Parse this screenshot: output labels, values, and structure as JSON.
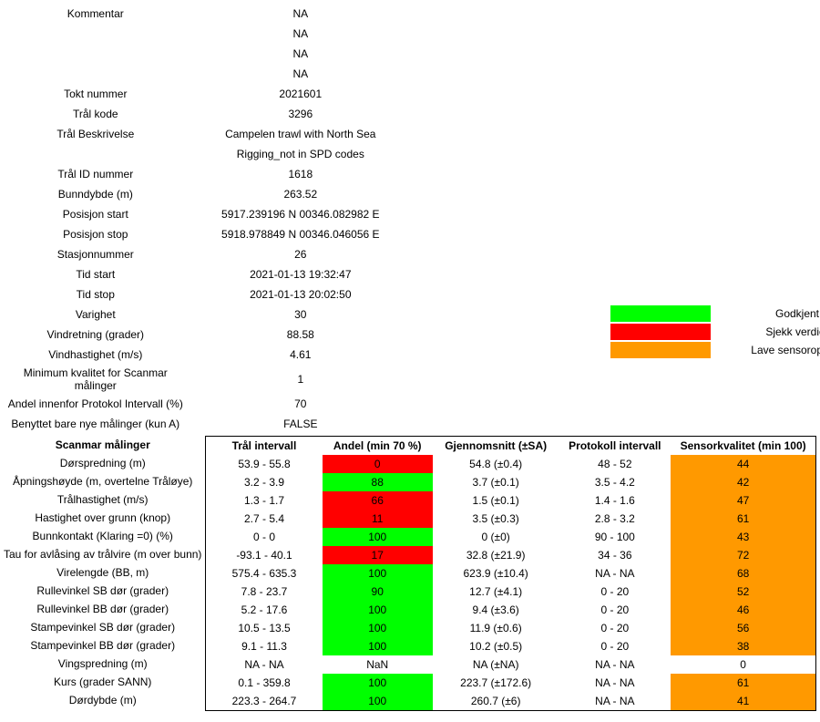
{
  "meta": [
    {
      "label": "Kommentar",
      "value": "NA"
    },
    {
      "label": "",
      "value": "NA"
    },
    {
      "label": "",
      "value": "NA"
    },
    {
      "label": "",
      "value": "NA"
    },
    {
      "label": "Tokt nummer",
      "value": "2021601"
    },
    {
      "label": "Trål kode",
      "value": "3296"
    },
    {
      "label": "Trål Beskrivelse",
      "value": "Campelen trawl with North Sea"
    },
    {
      "label": "",
      "value": "Rigging_not in SPD codes"
    },
    {
      "label": "Trål ID nummer",
      "value": "1618"
    },
    {
      "label": "Bunndybde (m)",
      "value": "263.52"
    },
    {
      "label": "Posisjon start",
      "value": "5917.239196 N 00346.082982 E"
    },
    {
      "label": "Posisjon stop",
      "value": "5918.978849 N 00346.046056 E"
    },
    {
      "label": "Stasjonnummer",
      "value": "26"
    },
    {
      "label": "Tid start",
      "value": "2021-01-13 19:32:47"
    },
    {
      "label": "Tid stop",
      "value": "2021-01-13 20:02:50"
    },
    {
      "label": "Varighet",
      "value": "30"
    },
    {
      "label": "Vindretning (grader)",
      "value": "88.58"
    },
    {
      "label": "Vindhastighet (m/s)",
      "value": "4.61"
    },
    {
      "label": "Minimum kvalitet for Scanmar målinger",
      "value": "1"
    },
    {
      "label": "Andel innenfor Protokol Intervall (%)",
      "value": "70"
    },
    {
      "label": "Benyttet bare nye målinger (kun A)",
      "value": "FALSE"
    }
  ],
  "legend": [
    {
      "color": "green",
      "label": "Godkjent"
    },
    {
      "color": "red",
      "label": "Sjekk verdier"
    },
    {
      "color": "orange",
      "label": "Lave sensoropptak"
    }
  ],
  "headers": {
    "rowhead": "Scanmar målinger",
    "interval": "Trål intervall",
    "andel": "Andel (min 70 %)",
    "mean": "Gjennomsnitt (±SA)",
    "proto": "Protokoll intervall",
    "sq": "Sensorkvalitet (min 100)"
  },
  "rows": [
    {
      "name": "Dørspredning (m)",
      "interval": "53.9 - 55.8",
      "andel": "0",
      "andel_c": "red",
      "mean": "54.8 (±0.4)",
      "proto": "48 - 52",
      "sq": "44",
      "sq_c": "orange"
    },
    {
      "name": "Åpningshøyde (m, overtelne Tråløye)",
      "interval": "3.2 - 3.9",
      "andel": "88",
      "andel_c": "green",
      "mean": "3.7 (±0.1)",
      "proto": "3.5 - 4.2",
      "sq": "42",
      "sq_c": "orange"
    },
    {
      "name": "Trålhastighet (m/s)",
      "interval": "1.3 - 1.7",
      "andel": "66",
      "andel_c": "red",
      "mean": "1.5 (±0.1)",
      "proto": "1.4 - 1.6",
      "sq": "47",
      "sq_c": "orange"
    },
    {
      "name": "Hastighet over grunn (knop)",
      "interval": "2.7 - 5.4",
      "andel": "11",
      "andel_c": "red",
      "mean": "3.5 (±0.3)",
      "proto": "2.8 - 3.2",
      "sq": "61",
      "sq_c": "orange"
    },
    {
      "name": "Bunnkontakt (Klaring =0) (%)",
      "interval": "0 - 0",
      "andel": "100",
      "andel_c": "green",
      "mean": "0 (±0)",
      "proto": "90 - 100",
      "sq": "43",
      "sq_c": "orange"
    },
    {
      "name": "Tau for avlåsing av trålvire (m over bunn)",
      "interval": "-93.1 - 40.1",
      "andel": "17",
      "andel_c": "red",
      "mean": "32.8 (±21.9)",
      "proto": "34 - 36",
      "sq": "72",
      "sq_c": "orange"
    },
    {
      "name": "Virelengde (BB, m)",
      "interval": "575.4 - 635.3",
      "andel": "100",
      "andel_c": "green",
      "mean": "623.9 (±10.4)",
      "proto": "NA - NA",
      "sq": "68",
      "sq_c": "orange"
    },
    {
      "name": "Rullevinkel SB dør (grader)",
      "interval": "7.8 - 23.7",
      "andel": "90",
      "andel_c": "green",
      "mean": "12.7 (±4.1)",
      "proto": "0 - 20",
      "sq": "52",
      "sq_c": "orange"
    },
    {
      "name": "Rullevinkel BB dør (grader)",
      "interval": "5.2 - 17.6",
      "andel": "100",
      "andel_c": "green",
      "mean": "9.4 (±3.6)",
      "proto": "0 - 20",
      "sq": "46",
      "sq_c": "orange"
    },
    {
      "name": "Stampevinkel SB dør (grader)",
      "interval": "10.5 - 13.5",
      "andel": "100",
      "andel_c": "green",
      "mean": "11.9 (±0.6)",
      "proto": "0 - 20",
      "sq": "56",
      "sq_c": "orange"
    },
    {
      "name": "Stampevinkel BB dør (grader)",
      "interval": "9.1 - 11.3",
      "andel": "100",
      "andel_c": "green",
      "mean": "10.2 (±0.5)",
      "proto": "0 - 20",
      "sq": "38",
      "sq_c": "orange"
    },
    {
      "name": "Vingspredning (m)",
      "interval": "NA - NA",
      "andel": "NaN",
      "andel_c": "",
      "mean": "NA (±NA)",
      "proto": "NA - NA",
      "sq": "0",
      "sq_c": ""
    },
    {
      "name": "Kurs (grader SANN)",
      "interval": "0.1 - 359.8",
      "andel": "100",
      "andel_c": "green",
      "mean": "223.7 (±172.6)",
      "proto": "NA - NA",
      "sq": "61",
      "sq_c": "orange"
    },
    {
      "name": "Dørdybde (m)",
      "interval": "223.3 - 264.7",
      "andel": "100",
      "andel_c": "green",
      "mean": "260.7 (±6)",
      "proto": "NA - NA",
      "sq": "41",
      "sq_c": "orange"
    }
  ]
}
